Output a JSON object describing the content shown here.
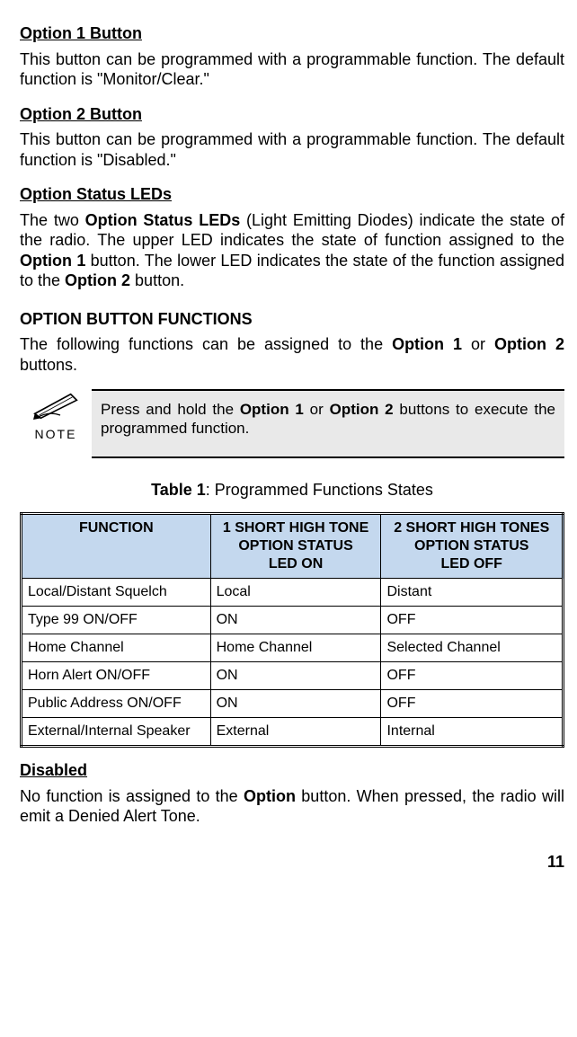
{
  "sections": {
    "opt1_h": "Option 1 Button",
    "opt1_p": "This button can be programmed with a programmable function.  The default function is \"Monitor/Clear.\"",
    "opt2_h": "Option 2 Button",
    "opt2_p": "This button can be programmed with a programmable function.  The default function is \"Disabled.\"",
    "leds_h": "Option Status LEDs",
    "leds_p_pre": "The two ",
    "leds_p_b1": "Option Status LEDs",
    "leds_p_mid1": " (Light Emitting Diodes) indicate the state of the radio. The upper LED indicates the state of function assigned to the ",
    "leds_p_b2": "Option 1",
    "leds_p_mid2": " button.  The lower LED indicates the state of the function assigned to the ",
    "leds_p_b3": "Option 2",
    "leds_p_post": " button.",
    "funcs_h": "OPTION BUTTON FUNCTIONS",
    "funcs_p_pre": "The following functions can be assigned to the ",
    "funcs_p_b1": "Option 1",
    "funcs_p_mid": " or ",
    "funcs_p_b2": "Option 2",
    "funcs_p_post": " buttons."
  },
  "note": {
    "label": "NOTE",
    "text_pre": "Press and hold the ",
    "text_b1": "Option 1",
    "text_mid": " or ",
    "text_b2": "Option 2",
    "text_post": " buttons to execute the programmed function."
  },
  "table": {
    "title_b": "Table 1",
    "title_rest": ": Programmed Functions States",
    "headers": {
      "c1": "FUNCTION",
      "c2a": "1 SHORT HIGH TONE",
      "c2b": "OPTION STATUS",
      "c2c": "LED ON",
      "c3a": "2 SHORT HIGH TONES",
      "c3b": "OPTION STATUS",
      "c3c": "LED OFF"
    },
    "rows": [
      {
        "f": "Local/Distant Squelch",
        "on": "Local",
        "off": "Distant"
      },
      {
        "f": "Type 99 ON/OFF",
        "on": "ON",
        "off": "OFF"
      },
      {
        "f": "Home Channel",
        "on": "Home Channel",
        "off": "Selected Channel"
      },
      {
        "f": "Horn Alert ON/OFF",
        "on": "ON",
        "off": "OFF"
      },
      {
        "f": "Public Address ON/OFF",
        "on": "ON",
        "off": "OFF"
      },
      {
        "f": "External/Internal Speaker",
        "on": "External",
        "off": "Internal"
      }
    ]
  },
  "disabled": {
    "h": "Disabled",
    "p_pre": "No function is assigned to the ",
    "p_b": "Option",
    "p_post": " button.  When pressed, the radio will emit a Denied Alert Tone."
  },
  "page_number": "11"
}
